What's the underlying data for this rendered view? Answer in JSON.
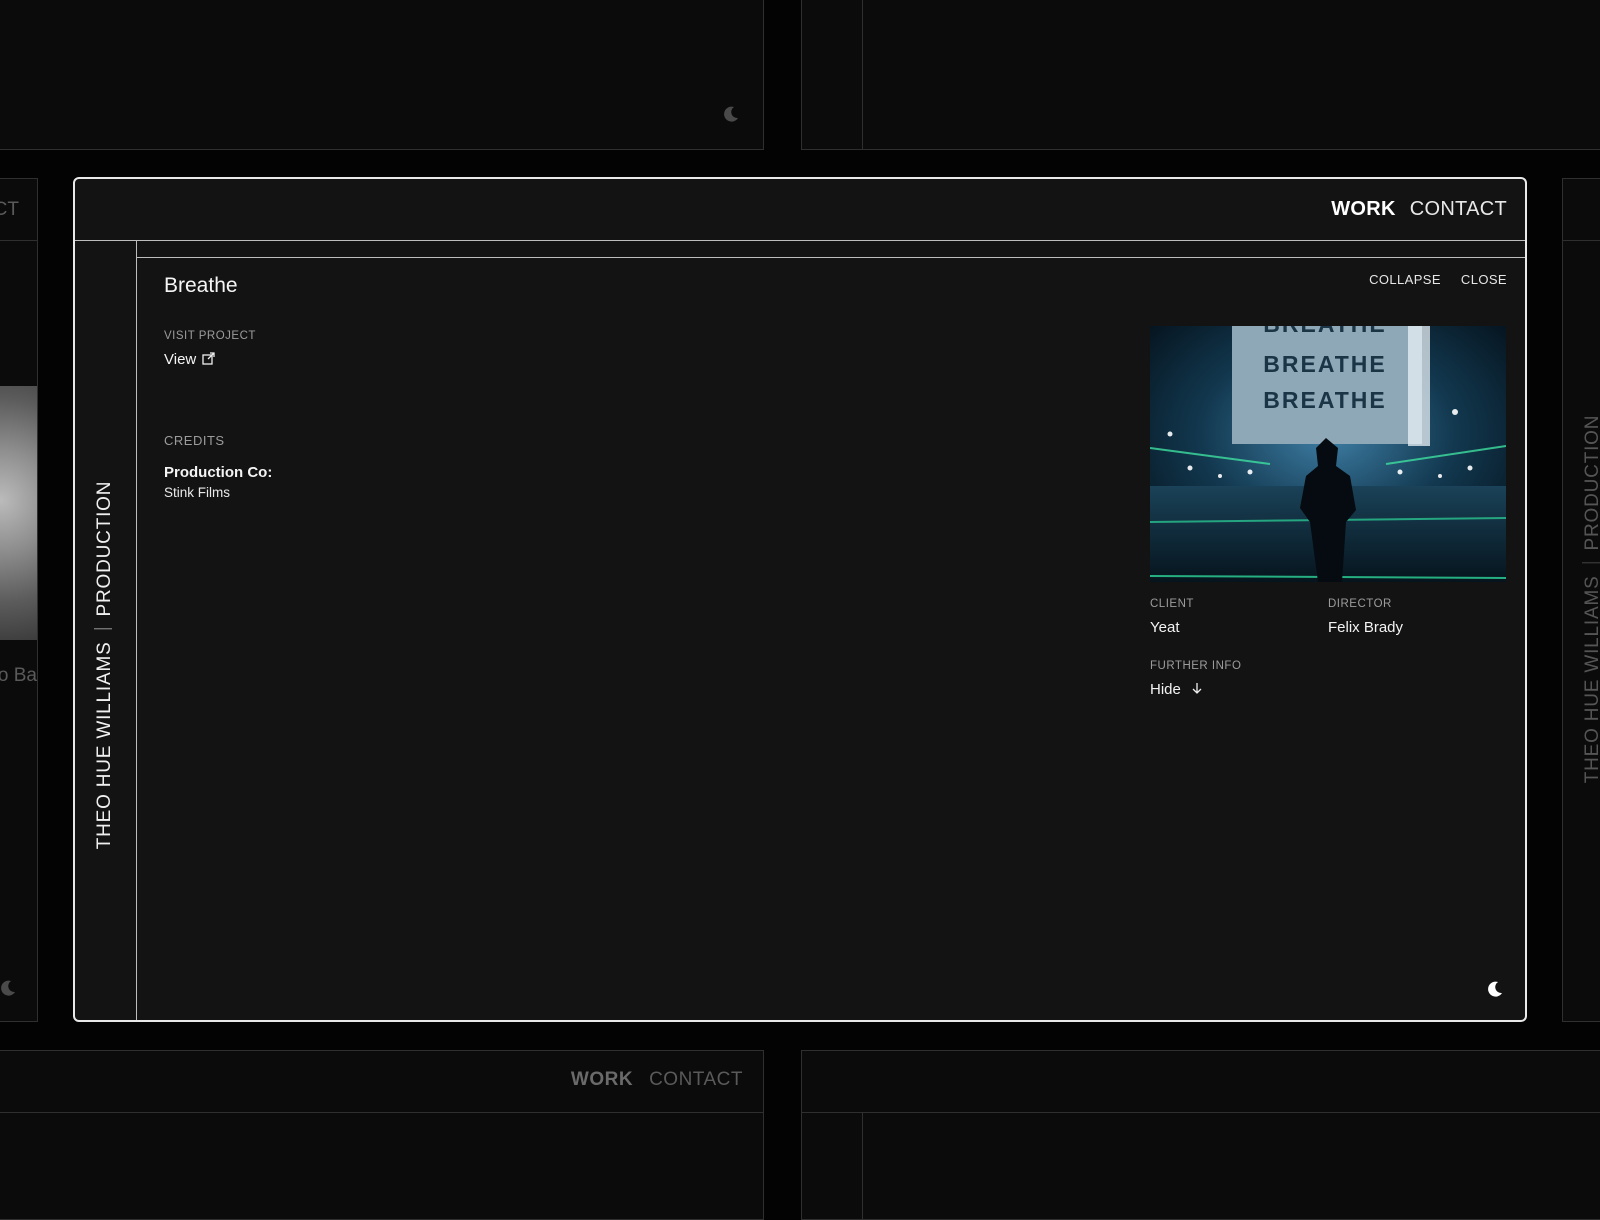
{
  "nav": {
    "work": "WORK",
    "contact": "CONTACT"
  },
  "sidebar": {
    "name": "THEO HUE WILLIAMS",
    "role": "PRODUCTION"
  },
  "project": {
    "title": "Breathe",
    "actions": {
      "collapse": "COLLAPSE",
      "close": "CLOSE"
    },
    "visit": {
      "label": "VISIT PROJECT",
      "link": "View"
    },
    "credits": {
      "label": "CREDITS",
      "key": "Production Co:",
      "value": "Stink Films"
    },
    "image_text": [
      "BREATHE",
      "BREATHE",
      "BREATHE"
    ],
    "client": {
      "label": "CLIENT",
      "value": "Yeat"
    },
    "director": {
      "label": "DIRECTOR",
      "value": "Felix Brady"
    },
    "further": {
      "label": "FURTHER INFO",
      "value": "Hide"
    }
  },
  "background": {
    "left_nav_fragment": "CT",
    "left_title_fragment": "o Ba",
    "bottom_nav": {
      "work": "WORK",
      "contact": "CONTACT"
    },
    "right_sidebar": {
      "name": "THEO HUE WILLIAMS",
      "role": "PRODUCTION"
    }
  },
  "icons": [
    "moon-icon",
    "external-link-icon",
    "arrow-down-icon"
  ],
  "colors": {
    "background": "#030303",
    "panel": "#131313",
    "border": "#e9e9e9",
    "text": "#f5f5f5",
    "muted": "#9c9c9c"
  }
}
